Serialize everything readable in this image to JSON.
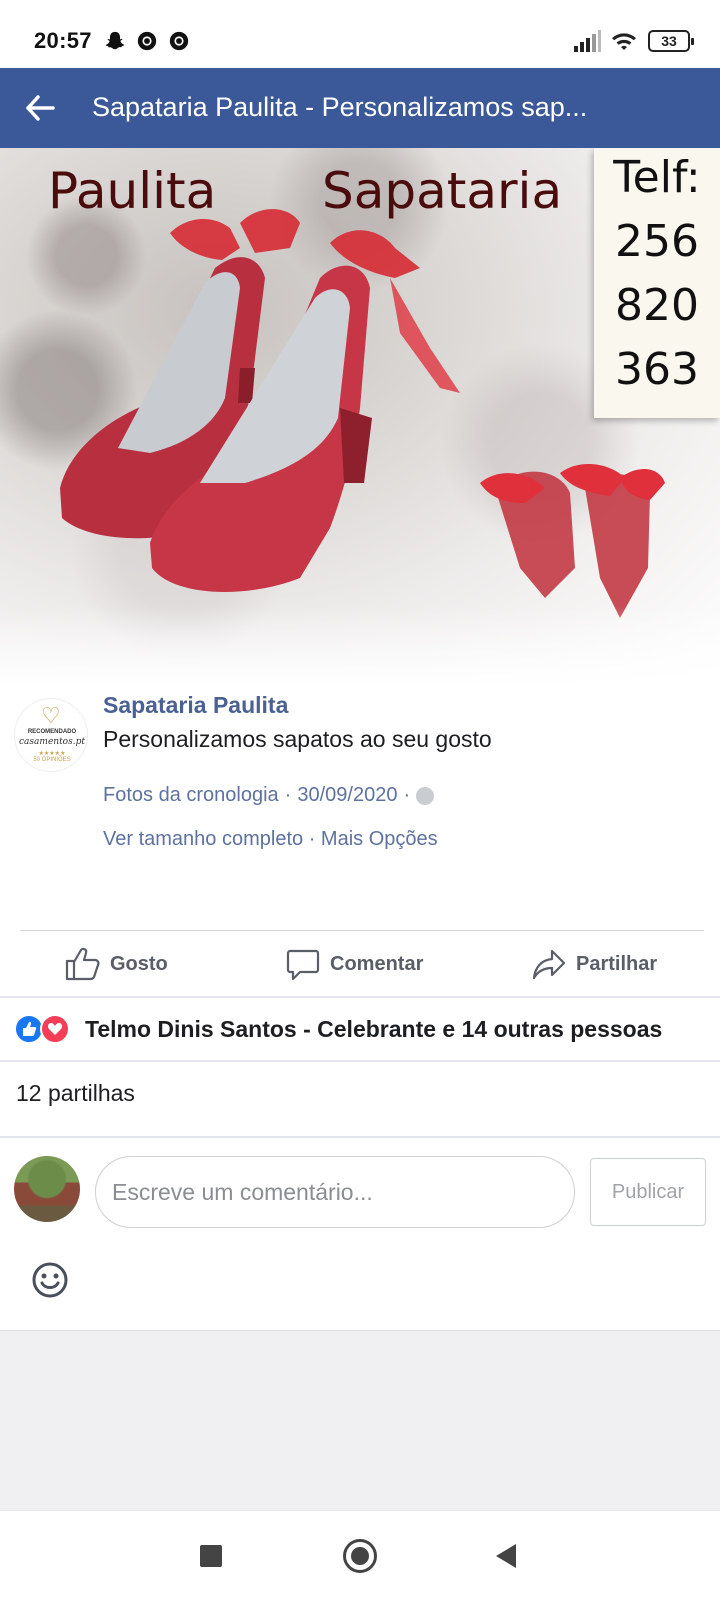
{
  "status_bar": {
    "time": "20:57",
    "battery": "33",
    "icons": [
      "snapchat-icon",
      "chrome-icon",
      "chrome-icon",
      "signal-icon",
      "wifi-icon",
      "battery-icon"
    ]
  },
  "app_bar": {
    "title": "Sapataria Paulita - Personalizamos sap...",
    "background": "#3b5998",
    "back_icon": "arrow-left-icon"
  },
  "photo": {
    "title_left": "Paulita",
    "title_right": "Sapataria",
    "phone_label": "Telf:",
    "phone_lines": [
      "256",
      "820",
      "363"
    ]
  },
  "badge": {
    "line1": "RECOMENDADO",
    "line2": "casamentos.pt",
    "stars": "★★★★★",
    "line3": "50 OPINIÕES"
  },
  "post": {
    "page_name": "Sapataria Paulita",
    "caption": "Personalizamos sapatos ao seu gosto",
    "album": "Fotos da cronologia",
    "date": "30/09/2020",
    "separator": "·",
    "view_full": "Ver tamanho completo",
    "more_options": "Mais Opções"
  },
  "actions": {
    "like": "Gosto",
    "comment": "Comentar",
    "share": "Partilhar"
  },
  "reactions": {
    "text": "Telmo Dinis Santos - Celebrante e 14 outras pessoas"
  },
  "shares": "12 partilhas",
  "comment_box": {
    "placeholder": "Escreve um comentário...",
    "publish": "Publicar"
  },
  "colors": {
    "link": "#5e72a0",
    "page_name": "#4b6194",
    "like_blue": "#1877f2",
    "love_red": "#f33e58"
  }
}
